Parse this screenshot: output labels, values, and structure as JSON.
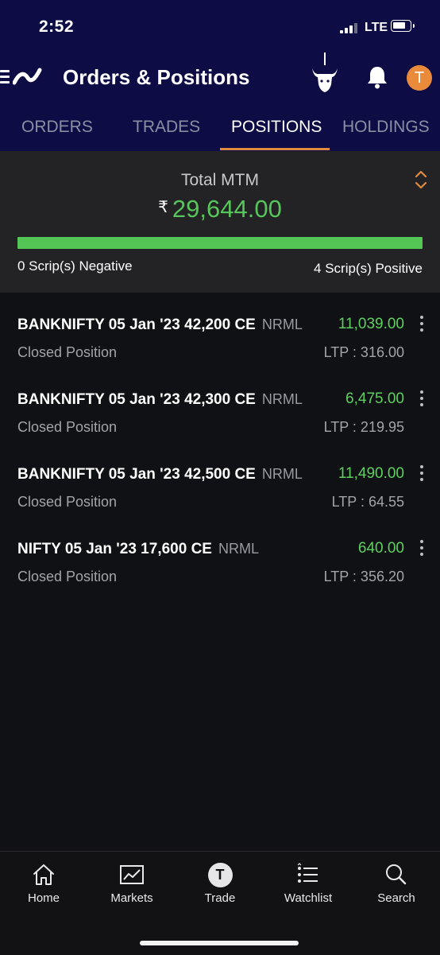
{
  "status_bar": {
    "time": "2:52",
    "network": "LTE"
  },
  "header": {
    "title": "Orders & Positions",
    "avatar_letter": "T"
  },
  "icons": {
    "menu": "menu-icon",
    "logo": "logo-icon",
    "bull": "bull-icon",
    "bell": "bell-icon",
    "sort": "sort-icon",
    "more": "more-vertical-icon"
  },
  "tabs": [
    {
      "label": "ORDERS",
      "active": false
    },
    {
      "label": "TRADES",
      "active": false
    },
    {
      "label": "POSITIONS",
      "active": true
    },
    {
      "label": "HOLDINGS",
      "active": false
    }
  ],
  "mtm": {
    "label": "Total MTM",
    "currency_symbol": "₹",
    "value": "29,644.00",
    "positive_fraction": 1.0,
    "negative_label": "0 Scrip(s) Negative",
    "positive_label": "4 Scrip(s) Positive"
  },
  "positions": [
    {
      "name": "BANKNIFTY 05 Jan '23 42,200 CE",
      "product": "NRML",
      "pnl": "11,039.00",
      "status": "Closed Position",
      "ltp": "LTP : 316.00"
    },
    {
      "name": "BANKNIFTY 05 Jan '23 42,300 CE",
      "product": "NRML",
      "pnl": "6,475.00",
      "status": "Closed Position",
      "ltp": "LTP : 219.95"
    },
    {
      "name": "BANKNIFTY 05 Jan '23 42,500 CE",
      "product": "NRML",
      "pnl": "11,490.00",
      "status": "Closed Position",
      "ltp": "LTP : 64.55"
    },
    {
      "name": "NIFTY 05 Jan '23 17,600 CE",
      "product": "NRML",
      "pnl": "640.00",
      "status": "Closed Position",
      "ltp": "LTP : 356.20"
    }
  ],
  "bottom_nav": [
    {
      "label": "Home",
      "icon": "home-icon"
    },
    {
      "label": "Markets",
      "icon": "chart-icon"
    },
    {
      "label": "Trade",
      "icon": "trade-icon",
      "icon_letter": "T"
    },
    {
      "label": "Watchlist",
      "icon": "watchlist-icon"
    },
    {
      "label": "Search",
      "icon": "search-icon"
    }
  ],
  "colors": {
    "header_bg": "#0e0c44",
    "accent": "#e08a3f",
    "positive": "#57c65a",
    "background": "#101114",
    "card_bg": "#232325"
  }
}
